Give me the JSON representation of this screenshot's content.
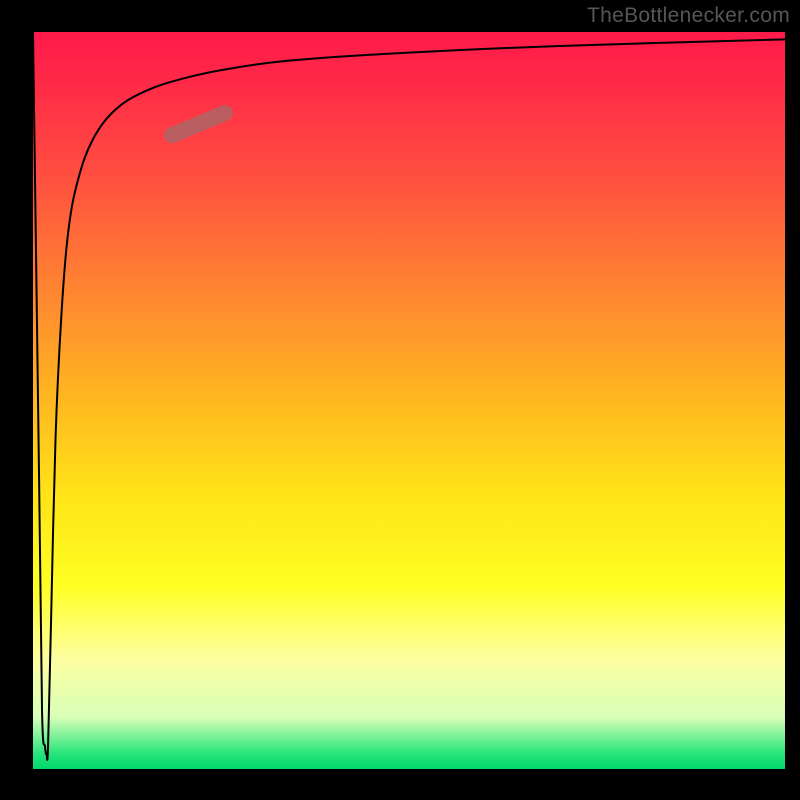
{
  "watermark": "TheBottlenecker.com",
  "chart_data": {
    "type": "line",
    "title": "",
    "xlabel": "",
    "ylabel": "",
    "xlim": [
      0,
      100
    ],
    "ylim": [
      0,
      100
    ],
    "note": "No numeric axis ticks are shown; values below are estimated normalized positions (0-100) read from the curve shape relative to the plot box. Lower y corresponds to green (good), higher y to red (bad).",
    "series": [
      {
        "name": "bottleneck-curve",
        "x": [
          0.0,
          0.8,
          1.2,
          1.6,
          1.8,
          2.0,
          2.4,
          3.0,
          3.8,
          4.7,
          6.0,
          8.0,
          11.0,
          15.0,
          20.0,
          26.0,
          35.0,
          50.0,
          70.0,
          100.0
        ],
        "y": [
          100,
          40,
          8,
          3,
          2,
          3,
          20,
          45,
          62,
          73,
          80,
          85.5,
          89.5,
          92,
          93.7,
          95,
          96.2,
          97.2,
          98.1,
          99.0
        ]
      },
      {
        "name": "highlight-segment",
        "x": [
          18.5,
          25.5
        ],
        "y": [
          86.0,
          89.0
        ]
      }
    ],
    "gradient_stops": [
      {
        "pos": 0,
        "color": "#ff1a4a"
      },
      {
        "pos": 50,
        "color": "#ffe418"
      },
      {
        "pos": 100,
        "color": "#00d86c"
      }
    ]
  }
}
